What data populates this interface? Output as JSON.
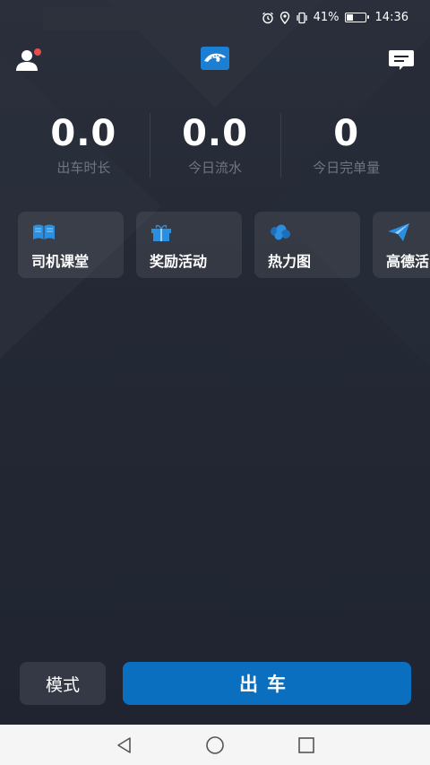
{
  "status_bar": {
    "battery_percent": "41%",
    "battery_level": 0.41,
    "time": "14:36",
    "icons": [
      "alarm-icon",
      "location-icon",
      "vibrate-icon",
      "battery-icon"
    ]
  },
  "header": {
    "icons": [
      "user-icon",
      "app-logo-icon",
      "message-icon"
    ],
    "notify_color": "#e84c4c"
  },
  "stats": [
    {
      "value": "0.0",
      "label": "出车时长"
    },
    {
      "value": "0.0",
      "label": "今日流水"
    },
    {
      "value": "0",
      "label": "今日完单量"
    }
  ],
  "features": [
    {
      "label": "司机课堂",
      "icon": "book-icon"
    },
    {
      "label": "奖励活动",
      "icon": "gift-icon"
    },
    {
      "label": "热力图",
      "icon": "heatmap-icon"
    },
    {
      "label": "高德活",
      "icon": "paper-plane-icon"
    }
  ],
  "actions": {
    "mode_label": "模式",
    "go_label": "出车"
  },
  "colors": {
    "accent": "#0a6fbf",
    "icon_blue": "#2b8fe0",
    "background": "#1f2430"
  }
}
